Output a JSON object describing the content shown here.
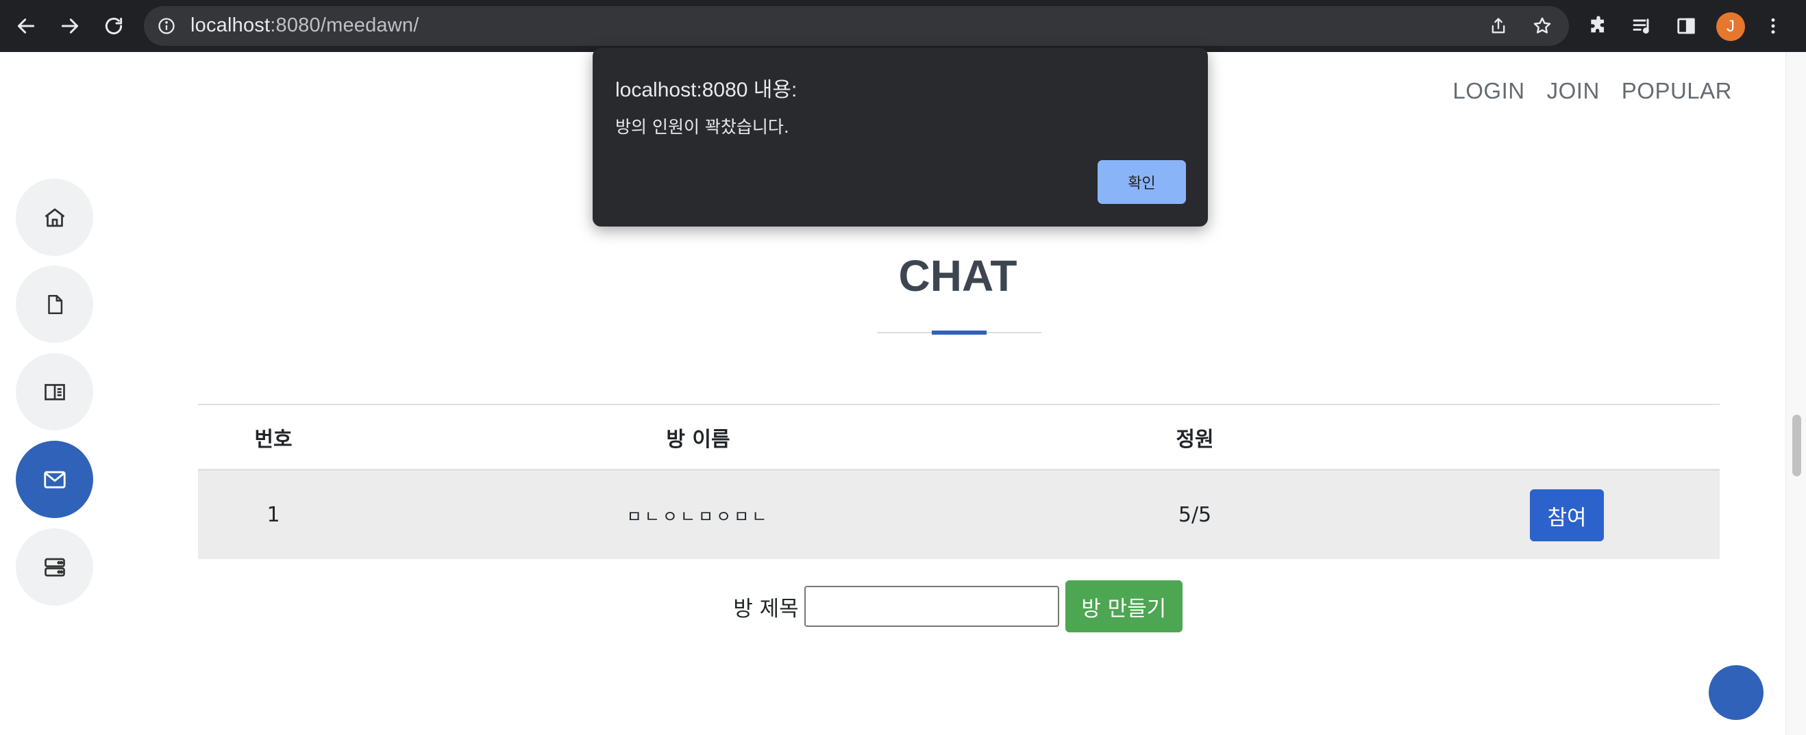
{
  "browser": {
    "url_host": "localhost",
    "url_path": ":8080/meedawn/",
    "profile_initial": "J"
  },
  "nav": {
    "login": "LOGIN",
    "join": "JOIN",
    "popular": "POPULAR"
  },
  "sidebar": {
    "items": [
      {
        "icon": "home-icon"
      },
      {
        "icon": "document-icon"
      },
      {
        "icon": "book-icon"
      },
      {
        "icon": "mail-icon",
        "active": true
      },
      {
        "icon": "server-icon"
      }
    ]
  },
  "section": {
    "title": "CHAT"
  },
  "table": {
    "headers": [
      "번호",
      "방 이름",
      "정원",
      ""
    ],
    "rows": [
      {
        "number": "1",
        "name": "ㅁㄴㅇㄴㅁㅇㅁㄴ",
        "capacity": "5/5",
        "action": "참여"
      }
    ]
  },
  "create": {
    "label": "방 제목",
    "input_value": "",
    "button": "방 만들기"
  },
  "dialog": {
    "title": "localhost:8080 내용:",
    "message": "방의 인원이 꽉찼습니다.",
    "ok": "확인"
  },
  "colors": {
    "accent": "#2f62b8",
    "join_button": "#2c62cc",
    "create_button": "#4da651",
    "dialog_bg": "#292a2d",
    "dialog_ok": "#8ab4f8"
  }
}
